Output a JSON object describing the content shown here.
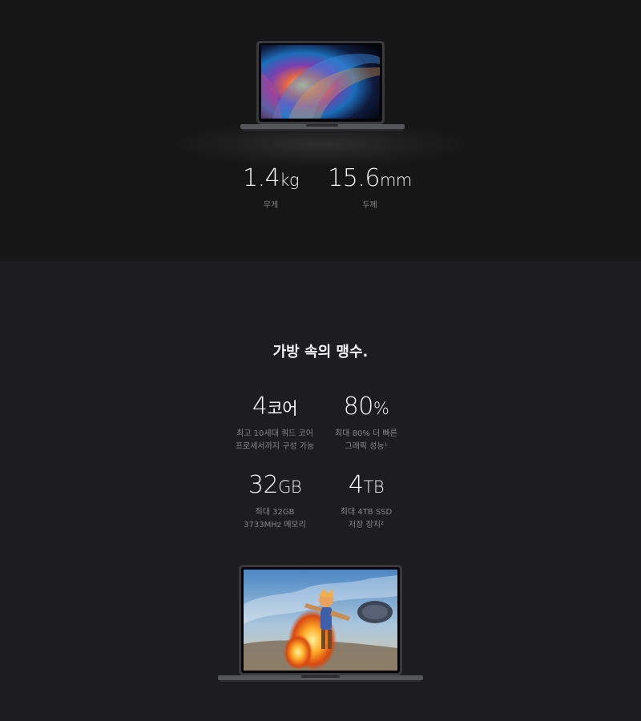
{
  "top": {
    "weight": {
      "value": "1.4",
      "unit": "kg",
      "caption": "무게"
    },
    "thickness": {
      "value": "15.6",
      "unit": "mm",
      "caption": "두께"
    }
  },
  "section": {
    "headline": "가방 속의 맹수.",
    "specs": [
      {
        "value": "4",
        "unit": "코어",
        "line1": "최고 10세대 쿼드 코어",
        "line2": "프로세서까지 구성 가능"
      },
      {
        "value": "80",
        "unit": "%",
        "line1": "최대 80% 더 빠른",
        "line2": "그래픽 성능¹"
      },
      {
        "value": "32",
        "unit": "GB",
        "line1": "최대 32GB",
        "line2": "3733MHz 메모리"
      },
      {
        "value": "4",
        "unit": "TB",
        "line1": "최대 4TB SSD",
        "line2": "저장 장치²"
      }
    ]
  },
  "colors": {
    "top_bg": "#161617",
    "bottom_bg": "#1d1d1f",
    "text": "#f5f5f7",
    "caption": "#86868b"
  }
}
